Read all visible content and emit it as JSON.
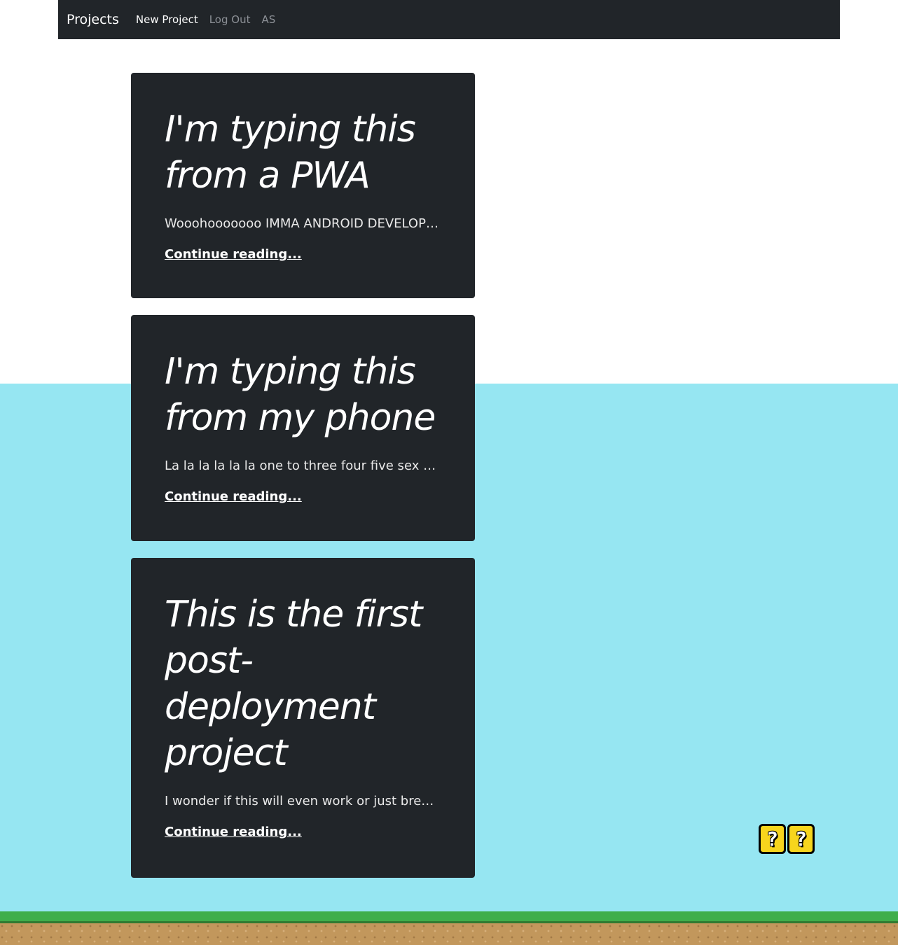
{
  "navbar": {
    "brand": "Projects",
    "links": [
      {
        "label": "New Project",
        "state": "active"
      },
      {
        "label": "Log Out",
        "state": "muted"
      },
      {
        "label": "AS",
        "state": "muted"
      }
    ]
  },
  "posts": [
    {
      "title": "I'm typing this from a PWA",
      "excerpt": "Wooohooooooo IMMA ANDROID DEVELOPER NOW",
      "link_label": "Continue reading..."
    },
    {
      "title": "I'm typing this from my phone",
      "excerpt": "La la la la la la one to three four five sex seven eight",
      "link_label": "Continue reading..."
    },
    {
      "title": "This is the first post-deployment project",
      "excerpt": "I wonder if this will even work or just break everything",
      "link_label": "Continue reading..."
    }
  ],
  "decor": {
    "question_blocks": [
      "?",
      "?"
    ],
    "colors": {
      "navbar_bg": "#212529",
      "card_bg": "#212529",
      "sky": "#96e6f2",
      "grass": "#3fae4a",
      "dirt": "#c2975c",
      "question_block": "#f7d51d"
    }
  }
}
